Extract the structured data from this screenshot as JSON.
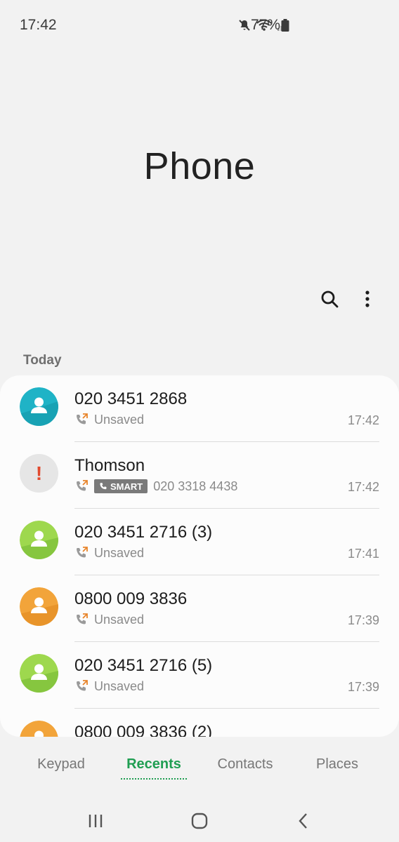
{
  "status_bar": {
    "time": "17:42",
    "battery": "77%",
    "icons": [
      "mute-icon",
      "wifi-icon",
      "signal-icon",
      "battery-icon"
    ]
  },
  "header": {
    "title": "Phone"
  },
  "toolbar": {
    "icons": [
      "search-icon",
      "more-options-icon"
    ]
  },
  "section": {
    "label": "Today"
  },
  "calls": [
    {
      "name": "020 3451 2868",
      "detail": "Unsaved",
      "time": "17:42",
      "avatar_color": "#1fb3c6",
      "type": "outgoing"
    },
    {
      "name": "Thomson",
      "badge": "SMART",
      "detail": "020 3318 4438",
      "time": "17:42",
      "avatar_color": "#e6e6e6",
      "type": "outgoing"
    },
    {
      "name": "020 3451 2716 (3)",
      "detail": "Unsaved",
      "time": "17:41",
      "avatar_color": "#8fd14f",
      "type": "outgoing"
    },
    {
      "name": "0800 009 3836",
      "detail": "Unsaved",
      "time": "17:39",
      "avatar_color": "#f0a030",
      "type": "outgoing"
    },
    {
      "name": "020 3451 2716 (5)",
      "detail": "Unsaved",
      "time": "17:39",
      "avatar_color": "#8fd14f",
      "type": "outgoing"
    },
    {
      "name": "0800 009 3836 (2)",
      "detail": "",
      "time": "",
      "avatar_color": "#f0a030",
      "type": "outgoing"
    }
  ],
  "tabs": [
    {
      "label": "Keypad",
      "active": false
    },
    {
      "label": "Recents",
      "active": true
    },
    {
      "label": "Contacts",
      "active": false
    },
    {
      "label": "Places",
      "active": false
    }
  ],
  "nav_bar": {
    "icons": [
      "recent-apps-icon",
      "home-icon",
      "back-icon"
    ]
  },
  "colors": {
    "accent": "#1f9e52",
    "background": "#f2f2f2",
    "alert": "#e24a2e"
  }
}
